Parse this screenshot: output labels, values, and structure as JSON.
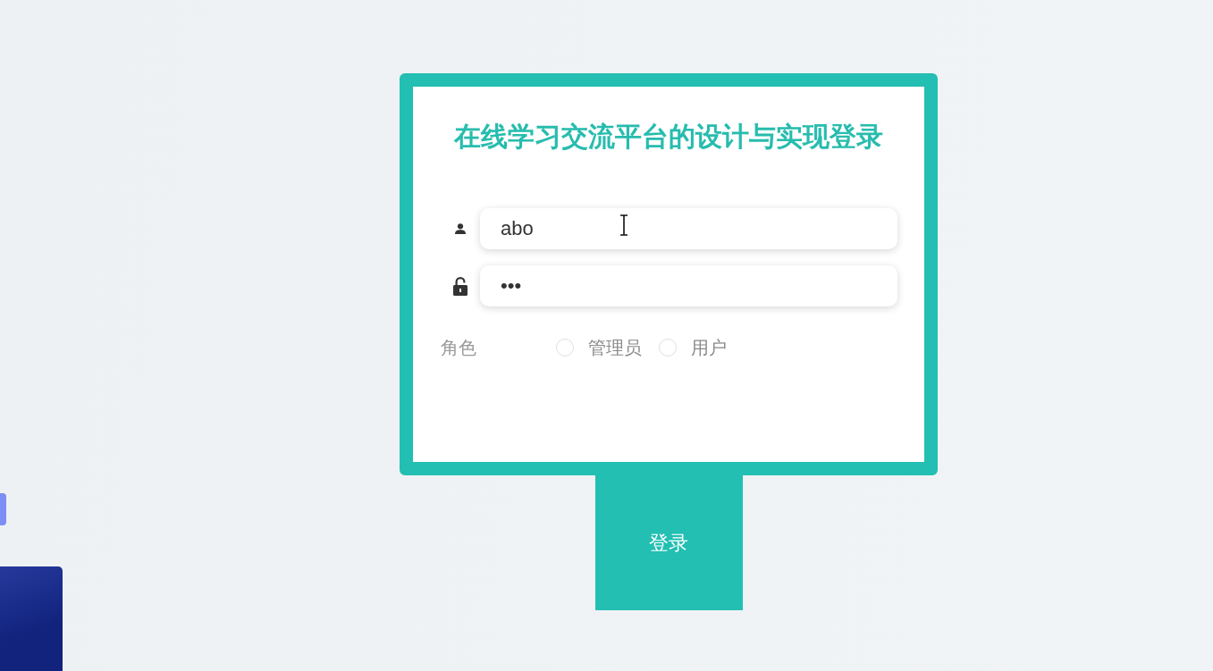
{
  "title": "在线学习交流平台的设计与实现登录",
  "fields": [
    {
      "kind": "user",
      "value": "abo"
    },
    {
      "kind": "lock",
      "value": "•••"
    }
  ],
  "role": {
    "label": "角色",
    "options": [
      {
        "label": "管理员",
        "selected": false
      },
      {
        "label": "用户",
        "selected": false
      }
    ]
  },
  "login_button": "登录"
}
